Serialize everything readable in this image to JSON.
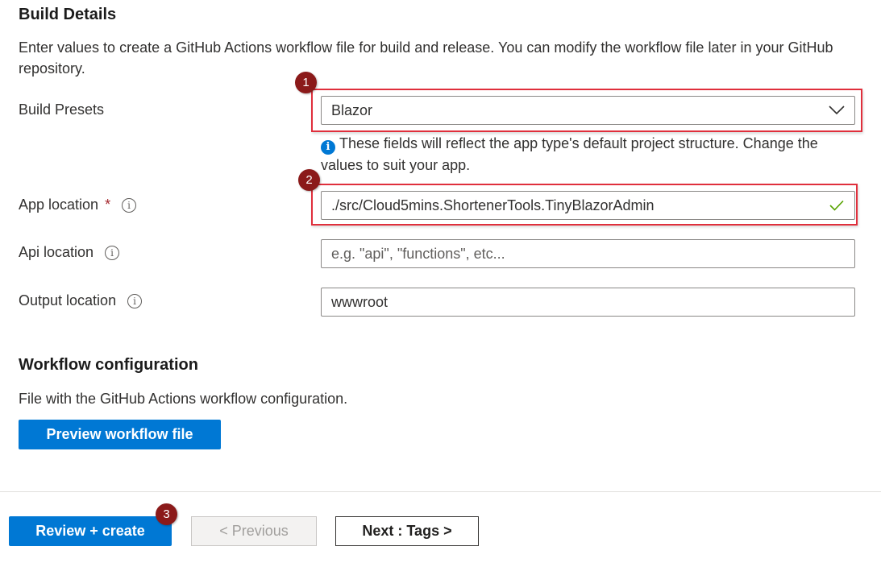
{
  "build_details": {
    "heading": "Build Details",
    "description": "Enter values to create a GitHub Actions workflow file for build and release. You can modify the workflow file later in your GitHub repository."
  },
  "build_presets": {
    "label": "Build Presets",
    "selected": "Blazor",
    "note": "These fields will reflect the app type's default project structure. Change the values to suit your app.",
    "note_icon": "info-filled-icon"
  },
  "app_location": {
    "label": "App location",
    "required_mark": "*",
    "value": "./src/Cloud5mins.ShortenerTools.TinyBlazorAdmin",
    "valid_icon": "checkmark-icon",
    "valid_color": "#57a300"
  },
  "api_location": {
    "label": "Api location",
    "value": "",
    "placeholder": "e.g. \"api\", \"functions\", etc..."
  },
  "output_location": {
    "label": "Output location",
    "value": "wwwroot"
  },
  "workflow": {
    "heading": "Workflow configuration",
    "description": "File with the GitHub Actions workflow configuration.",
    "preview_button": "Preview workflow file"
  },
  "footer": {
    "review_create": "Review + create",
    "previous": "< Previous",
    "next": "Next : Tags >"
  },
  "annotations": {
    "badge_1": "1",
    "badge_2": "2",
    "badge_3": "3",
    "highlight_color": "#e02f3c",
    "badge_color": "#8b1a1a"
  },
  "info_icon_glyph": "i",
  "accent_color": "#0078d4"
}
